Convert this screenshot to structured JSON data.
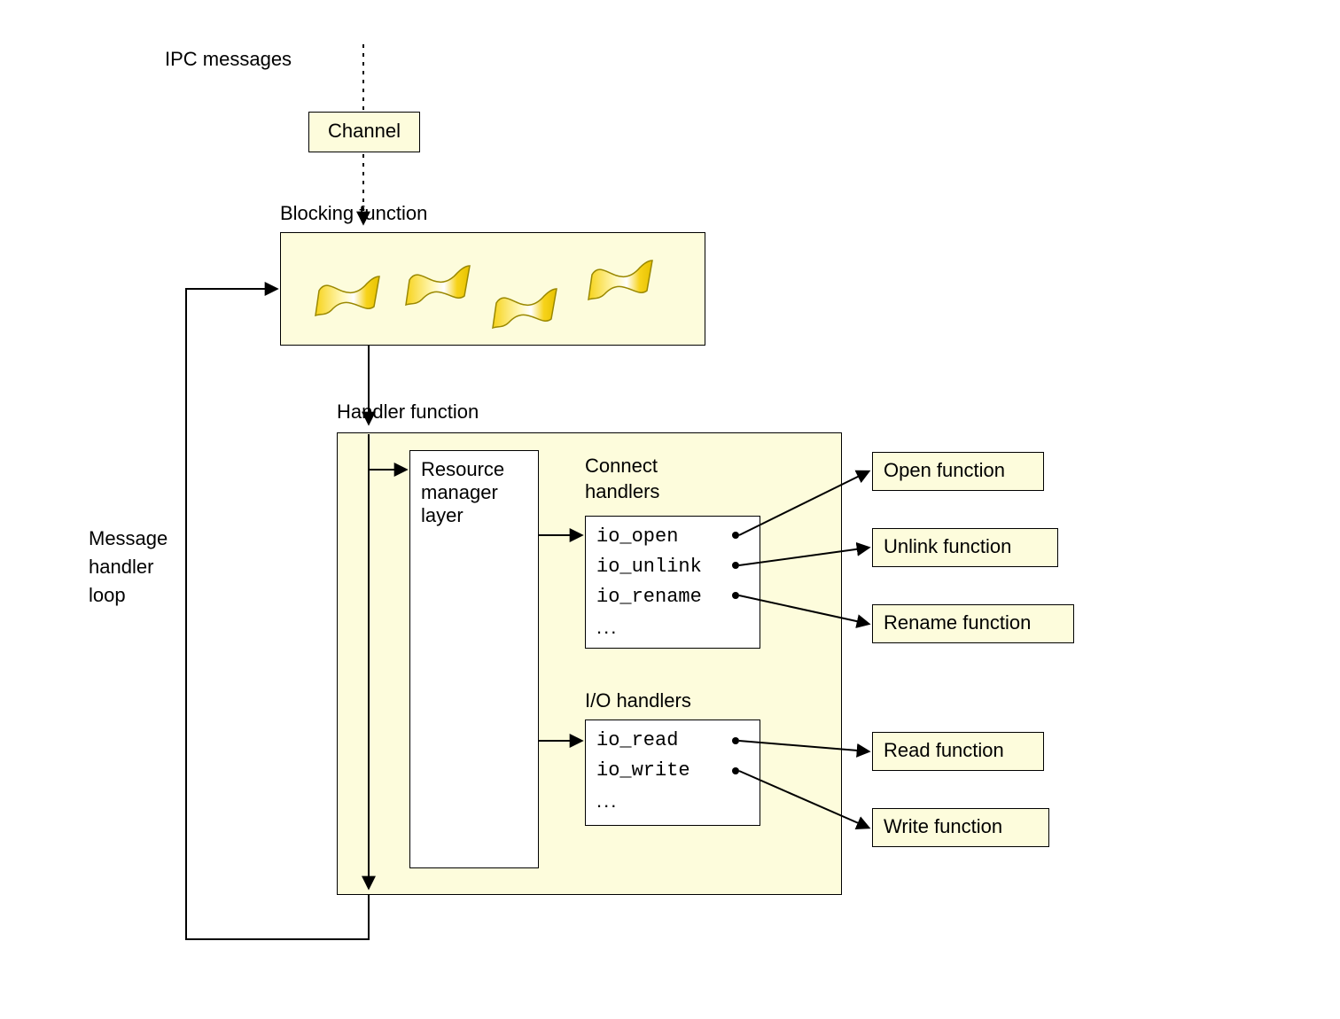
{
  "top": {
    "ipc_label": "IPC messages",
    "channel": "Channel"
  },
  "blocking": {
    "title": "Blocking function"
  },
  "loop_label": {
    "l1": "Message",
    "l2": "handler",
    "l3": "loop"
  },
  "handler": {
    "title": "Handler function",
    "resource": {
      "l1": "Resource",
      "l2": "manager",
      "l3": "layer"
    },
    "connect": {
      "title": "Connect",
      "title2": "handlers",
      "items": {
        "io_open": "io_open",
        "io_unlink": "io_unlink",
        "io_rename": "io_rename",
        "more": "..."
      }
    },
    "io": {
      "title": "I/O handlers",
      "items": {
        "io_read": "io_read",
        "io_write": "io_write",
        "more": "..."
      }
    }
  },
  "funcs": {
    "open": "Open function",
    "unlink": "Unlink function",
    "rename": "Rename function",
    "read": "Read function",
    "write": "Write function"
  }
}
